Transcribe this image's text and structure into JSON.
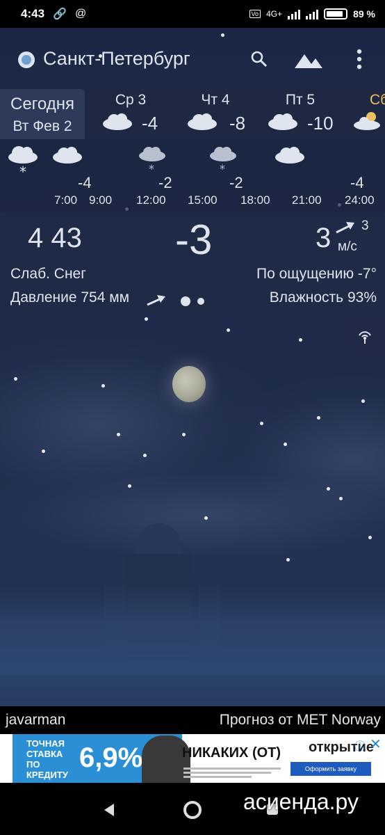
{
  "status_bar": {
    "time": "4:43",
    "icons": [
      "link-icon",
      "at-icon",
      "volte-icon",
      "signal-icon",
      "signal-icon",
      "battery-icon"
    ],
    "network": "4G+",
    "battery_pct": "89",
    "battery_level": 0.89
  },
  "header": {
    "city": "Санкт-Петербург",
    "icons": [
      "search-icon",
      "landscape-icon",
      "more-vert-icon"
    ]
  },
  "days": {
    "today_label": "Сегодня",
    "today_date": "Вт Фев 2",
    "items": [
      {
        "name": "Ср 3",
        "temp": "-4",
        "icon": "cloud-icon"
      },
      {
        "name": "Чт 4",
        "temp": "-8",
        "icon": "cloud-icon"
      },
      {
        "name": "Пт 5",
        "temp": "-10",
        "icon": "cloud-icon"
      },
      {
        "name": "Сб",
        "temp": "",
        "icon": "partly-cloudy-icon"
      }
    ]
  },
  "hourly": {
    "temps": [
      "-4",
      "-2",
      "-2",
      "-4"
    ],
    "times": [
      "7:00",
      "9:00",
      "12:00",
      "15:00",
      "18:00",
      "21:00",
      "24:00"
    ],
    "icons": [
      "snow-cloud-icon",
      "cloud-icon",
      "snow-cloud-icon",
      "snow-cloud-icon",
      "cloud-icon"
    ]
  },
  "current": {
    "time": "4  43",
    "temp": "-3",
    "wind": "3",
    "wind_speed": "3",
    "wind_unit": "м/с",
    "description": "Слаб. Снег",
    "feels_like": "По ощущению -7°",
    "pressure": "Давление 754 мм",
    "humidity": "Влажность 93%"
  },
  "footer": {
    "author": "javarman",
    "source": "Прогноз от MET Norway"
  },
  "ad": {
    "text1": "ТОЧНАЯ СТАВКА ПО КРЕДИТУ",
    "rate": "6,9%",
    "mid": "НИКАКИХ (ОТ)",
    "brand": "открытие",
    "cta": "Оформить заявку"
  },
  "watermark": "асиенда.ру"
}
